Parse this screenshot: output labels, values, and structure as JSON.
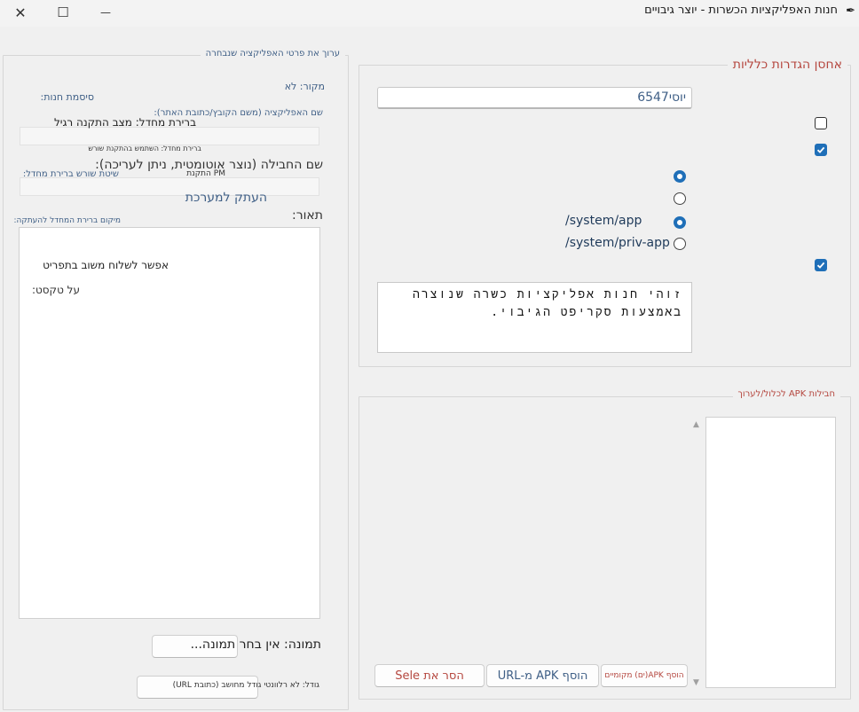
{
  "window": {
    "title": "חנות האפליקציות הכשרות - יוצר גיבויים",
    "controls": {
      "minimize": "—",
      "maximize": "☐",
      "close": "✕"
    }
  },
  "general": {
    "legend": "אחסן הגדרות כלליות",
    "store_password_label": "סיסמת חנות:",
    "store_password_value": "יוסי6547",
    "default_normal_install_label": "ברירת מחדל: מצב התקנה רגיל",
    "default_root_install_label": "ברירת מחדל: השתמש בהתקנת שורש",
    "default_root_method_label": "שיטת שורש ברירת מחדל:",
    "method_pm_label": "PM התקנת",
    "method_copy_label": "העתק למערכת",
    "copy_location_label": "מיקום ברירת המחדל להעתקה:",
    "loc_app_label": "/system/app",
    "loc_priv_label": "/system/priv-app",
    "allow_feedback_label": "אפשר לשלוח משוב בתפריט",
    "about_text_label": "על טקסט:",
    "about_text_value": "זוהי חנות אפליקציות כשרה שנוצרה באמצעות סקריפט הגיבוי."
  },
  "apk_packages": {
    "legend": "חבילות APK לכלול/לערוך",
    "scroll_up": "▲",
    "scroll_down": "▼",
    "add_local_button": "הוסף APK(ים) מקומיים",
    "add_url_button": "הוסף APK מ-URL",
    "remove_button": "הסר את Sele"
  },
  "details": {
    "legend": "ערוך את פרטי האפליקציה שנבחרה",
    "source_label": "מקור: לא",
    "app_name_label": "שם האפליקציה (משם הקובץ/כתובת האתר):",
    "package_name_label": "שם החבילה (נוצר אוטומטית, ניתן לעריכה):",
    "description_label": "תאור:",
    "image_label": "תמונה: אין בחר תמונה...",
    "size_label": "גודל: לא רלוונטי גודל מחושב (כתובת URL)"
  },
  "colors": {
    "accent": "#1f6fb8",
    "legend_red": "#b5473f",
    "label_blue": "#3f5f86"
  }
}
